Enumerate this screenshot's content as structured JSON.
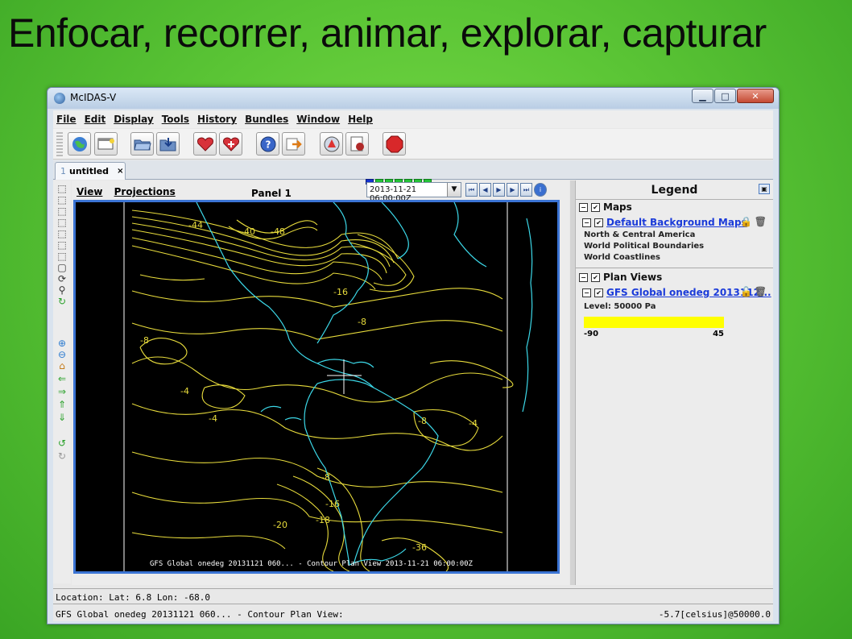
{
  "slide": {
    "title": "Enfocar, recorrer, animar, explorar, capturar"
  },
  "window": {
    "title": "McIDAS-V",
    "controls": {
      "minimize": "▁",
      "maximize": "□",
      "close": "✕"
    }
  },
  "menubar": {
    "items": [
      "File",
      "Edit",
      "Display",
      "Tools",
      "History",
      "Bundles",
      "Window",
      "Help"
    ]
  },
  "toolbar": {
    "buttons": [
      "globe-icon",
      "window-icon",
      "open-folder-icon",
      "save-icon",
      "favorite-heart-icon",
      "favorite-heart-edit-icon",
      "help-icon",
      "forward-icon",
      "data-explorer-icon",
      "layer-controls-icon",
      "stop-icon"
    ]
  },
  "tabs": [
    {
      "number": "1",
      "label": "untitled",
      "close": "×"
    }
  ],
  "view": {
    "menu": [
      "View",
      "Projections"
    ],
    "panel_title": "Panel 1",
    "time": "2013-11-21 06:00:00Z",
    "map_caption": "GFS Global onedeg 20131121 060... - Contour Plan View 2013-11-21 06:00:00Z",
    "colors": {
      "contour": "#e8dc3c",
      "coast": "#3cd8e8",
      "frame": "#3b74d4"
    },
    "contour_labels": [
      "-44",
      "-40",
      "-48",
      "-16",
      "-8",
      "-8",
      "-4",
      "-4",
      "-8",
      "-4",
      "-8",
      "-16",
      "-18",
      "-20",
      "-36"
    ]
  },
  "legend": {
    "title": "Legend",
    "groups": [
      {
        "name": "Maps",
        "layers": [
          {
            "name": "Default Background Maps",
            "items": [
              "North & Central America",
              "World Political Boundaries",
              "World Coastlines"
            ]
          }
        ]
      },
      {
        "name": "Plan Views",
        "layers": [
          {
            "name": "GFS Global onedeg 2013112...",
            "level": "Level: 50000 Pa",
            "range_min": "-90",
            "range_max": "45",
            "bar_color": "#ffff00"
          }
        ]
      }
    ]
  },
  "status": {
    "location": "Location: Lat: 6.8 Lon: -68.0",
    "layer": "GFS Global onedeg 20131121 060... - Contour Plan View:",
    "value": "-5.7[celsius]@50000.0"
  }
}
